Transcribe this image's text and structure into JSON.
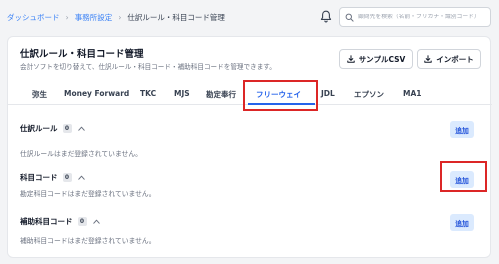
{
  "breadcrumb": {
    "items": [
      "ダッシュボード",
      "事務所設定"
    ],
    "current": "仕訳ルール・科目コード管理"
  },
  "search": {
    "placeholder": "顧問先を検索（名前・フリガナ・識別コード）"
  },
  "card": {
    "title": "仕訳ルール・科目コード管理",
    "subtitle": "会計ソフトを切り替えて、仕訳ルール・科目コード・補助科目コードを管理できます。",
    "sample_csv_label": "サンプルCSV",
    "import_label": "インポート"
  },
  "tabs": [
    {
      "label": "弥生"
    },
    {
      "label": "Money Forward"
    },
    {
      "label": "TKC"
    },
    {
      "label": "MJS"
    },
    {
      "label": "勘定奉行"
    },
    {
      "label": "フリーウェイ",
      "active": true
    },
    {
      "label": "JDL"
    },
    {
      "label": "エプソン"
    },
    {
      "label": "MA1"
    }
  ],
  "sections": [
    {
      "title": "仕訳ルール",
      "count": "0",
      "empty_text": "仕訳ルールはまだ登録されていません。",
      "add_label": "追加"
    },
    {
      "title": "科目コード",
      "count": "0",
      "empty_text": "勘定科目コードはまだ登録されていません。",
      "add_label": "追加"
    },
    {
      "title": "補助科目コード",
      "count": "0",
      "empty_text": "補助科目コードはまだ登録されていません。",
      "add_label": "追加"
    }
  ],
  "colors": {
    "accent": "#2563eb",
    "highlight": "#dc2626",
    "add_button_bg": "#dbeafe"
  },
  "icons": {
    "bell": "bell-icon",
    "search": "search-icon",
    "download": "download-icon",
    "chevron": "chevron-up-icon"
  }
}
